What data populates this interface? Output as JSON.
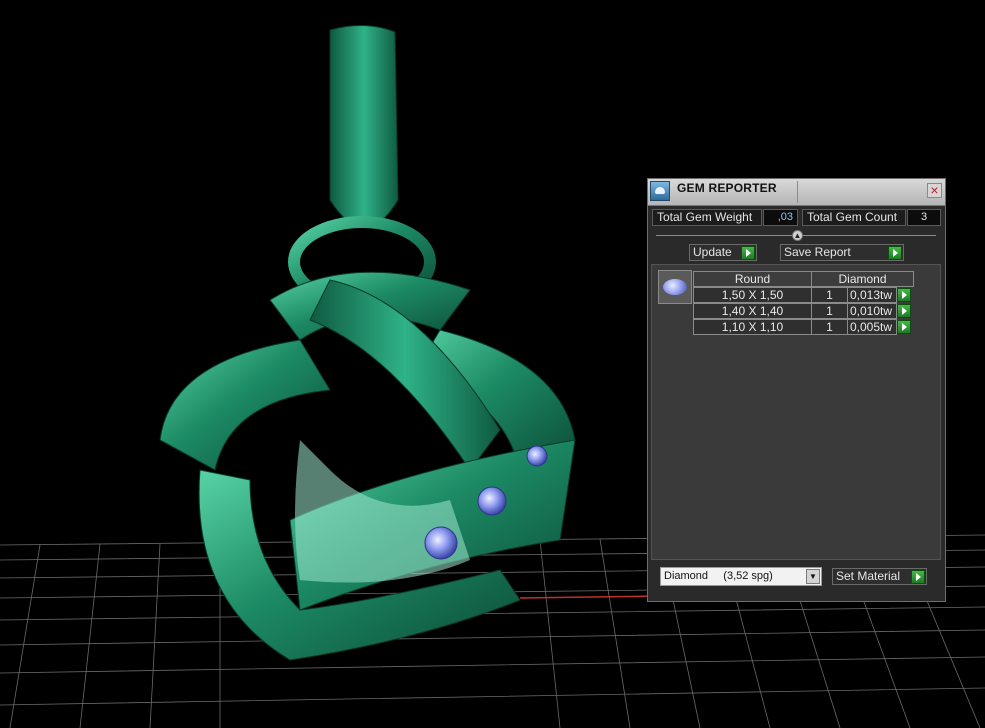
{
  "window": {
    "title": "GEM REPORTER",
    "close_glyph": "×"
  },
  "summary": {
    "weight_label": "Total Gem Weight",
    "weight_value": ",03",
    "count_label": "Total Gem Count",
    "count_value": "3"
  },
  "divider": {
    "knob_glyph": "▲"
  },
  "buttons": {
    "update": "Update",
    "save_report": "Save Report",
    "set_material": "Set Material"
  },
  "table": {
    "header": {
      "shape": "Round",
      "material": "Diamond"
    },
    "rows": [
      {
        "size": "1,50 X 1,50",
        "count": "1",
        "weight": "0,013tw"
      },
      {
        "size": "1,40 X 1,40",
        "count": "1",
        "weight": "0,010tw"
      },
      {
        "size": "1,10 X 1,10",
        "count": "1",
        "weight": "0,005tw"
      }
    ]
  },
  "material_select": {
    "value": "Diamond     (3,52 spg)",
    "arrow_glyph": "▼"
  },
  "colors": {
    "model": "#1f8a66",
    "gem": "#8f9cf0",
    "panel_bg": "#2a2a2a"
  }
}
